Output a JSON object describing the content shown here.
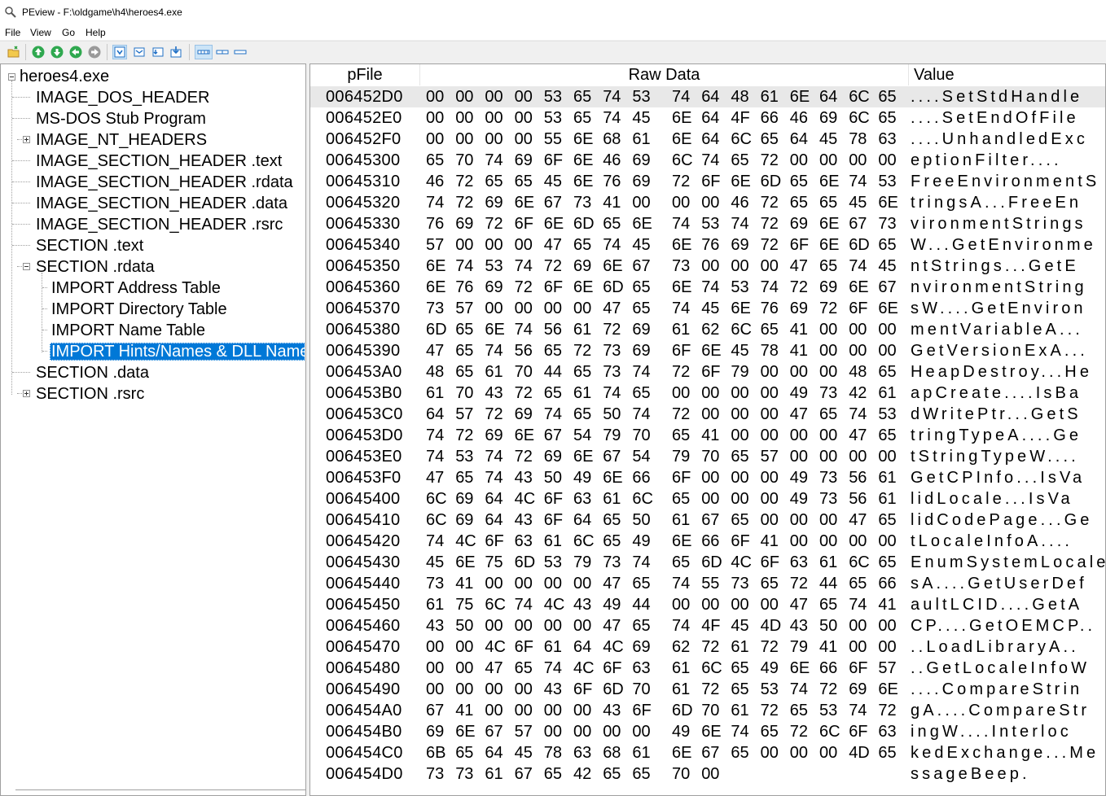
{
  "window": {
    "title": "PEview - F:\\oldgame\\h4\\heroes4.exe",
    "icon": "magnifier-icon"
  },
  "menu": [
    "File",
    "View",
    "Go",
    "Help"
  ],
  "toolbar": {
    "icons": [
      "open-folder-icon",
      "go-first-icon",
      "go-next-icon",
      "go-back-icon",
      "go-forward-icon",
      "view-byte-icon",
      "view-word-icon",
      "view-dword-icon",
      "view-qword-icon",
      "view-address-icon",
      "view-section-icon",
      "view-list-icon"
    ]
  },
  "tree": {
    "root": "heroes4.exe",
    "items": [
      {
        "label": "IMAGE_DOS_HEADER"
      },
      {
        "label": "MS-DOS Stub Program"
      },
      {
        "label": "IMAGE_NT_HEADERS",
        "expander": "plus"
      },
      {
        "label": "IMAGE_SECTION_HEADER .text"
      },
      {
        "label": "IMAGE_SECTION_HEADER .rdata"
      },
      {
        "label": "IMAGE_SECTION_HEADER .data"
      },
      {
        "label": "IMAGE_SECTION_HEADER .rsrc"
      },
      {
        "label": "SECTION .text"
      },
      {
        "label": "SECTION .rdata",
        "expander": "minus"
      },
      {
        "label": "IMPORT Address Table"
      },
      {
        "label": "IMPORT Directory Table"
      },
      {
        "label": "IMPORT Name Table"
      },
      {
        "label": "IMPORT Hints/Names & DLL Names",
        "selected": true
      },
      {
        "label": "SECTION .data"
      },
      {
        "label": "SECTION .rsrc",
        "expander": "plus"
      }
    ]
  },
  "columns": {
    "pfile": "pFile",
    "raw": "Raw Data",
    "value": "Value"
  },
  "rows": [
    {
      "addr": "006452D0",
      "h1": "00 00 00 00 53 65 74 53",
      "h2": "74 64 48 61 6E 64 6C 65",
      "val": "....SetStdHandle"
    },
    {
      "addr": "006452E0",
      "h1": "00 00 00 00 53 65 74 45",
      "h2": "6E 64 4F 66 46 69 6C 65",
      "val": "....SetEndOfFile"
    },
    {
      "addr": "006452F0",
      "h1": "00 00 00 00 55 6E 68 61",
      "h2": "6E 64 6C 65 64 45 78 63",
      "val": "....UnhandledExc"
    },
    {
      "addr": "00645300",
      "h1": "65 70 74 69 6F 6E 46 69",
      "h2": "6C 74 65 72 00 00 00 00",
      "val": "eptionFilter...."
    },
    {
      "addr": "00645310",
      "h1": "46 72 65 65 45 6E 76 69",
      "h2": "72 6F 6E 6D 65 6E 74 53",
      "val": "FreeEnvironmentS"
    },
    {
      "addr": "00645320",
      "h1": "74 72 69 6E 67 73 41 00",
      "h2": "00 00 46 72 65 65 45 6E",
      "val": "tringsA...FreeEn"
    },
    {
      "addr": "00645330",
      "h1": "76 69 72 6F 6E 6D 65 6E",
      "h2": "74 53 74 72 69 6E 67 73",
      "val": "vironmentStrings"
    },
    {
      "addr": "00645340",
      "h1": "57 00 00 00 47 65 74 45",
      "h2": "6E 76 69 72 6F 6E 6D 65",
      "val": "W...GetEnvironme"
    },
    {
      "addr": "00645350",
      "h1": "6E 74 53 74 72 69 6E 67",
      "h2": "73 00 00 00 47 65 74 45",
      "val": "ntStrings...GetE"
    },
    {
      "addr": "00645360",
      "h1": "6E 76 69 72 6F 6E 6D 65",
      "h2": "6E 74 53 74 72 69 6E 67",
      "val": "nvironmentString"
    },
    {
      "addr": "00645370",
      "h1": "73 57 00 00 00 00 47 65",
      "h2": "74 45 6E 76 69 72 6F 6E",
      "val": "sW....GetEnviron"
    },
    {
      "addr": "00645380",
      "h1": "6D 65 6E 74 56 61 72 69",
      "h2": "61 62 6C 65 41 00 00 00",
      "val": "mentVariableA..."
    },
    {
      "addr": "00645390",
      "h1": "47 65 74 56 65 72 73 69",
      "h2": "6F 6E 45 78 41 00 00 00",
      "val": "GetVersionExA..."
    },
    {
      "addr": "006453A0",
      "h1": "48 65 61 70 44 65 73 74",
      "h2": "72 6F 79 00 00 00 48 65",
      "val": "HeapDestroy...He"
    },
    {
      "addr": "006453B0",
      "h1": "61 70 43 72 65 61 74 65",
      "h2": "00 00 00 00 49 73 42 61",
      "val": "apCreate....IsBa"
    },
    {
      "addr": "006453C0",
      "h1": "64 57 72 69 74 65 50 74",
      "h2": "72 00 00 00 47 65 74 53",
      "val": "dWritePtr...GetS"
    },
    {
      "addr": "006453D0",
      "h1": "74 72 69 6E 67 54 79 70",
      "h2": "65 41 00 00 00 00 47 65",
      "val": "tringTypeA....Ge"
    },
    {
      "addr": "006453E0",
      "h1": "74 53 74 72 69 6E 67 54",
      "h2": "79 70 65 57 00 00 00 00",
      "val": "tStringTypeW...."
    },
    {
      "addr": "006453F0",
      "h1": "47 65 74 43 50 49 6E 66",
      "h2": "6F 00 00 00 49 73 56 61",
      "val": "GetCPInfo...IsVa"
    },
    {
      "addr": "00645400",
      "h1": "6C 69 64 4C 6F 63 61 6C",
      "h2": "65 00 00 00 49 73 56 61",
      "val": "lidLocale...IsVa"
    },
    {
      "addr": "00645410",
      "h1": "6C 69 64 43 6F 64 65 50",
      "h2": "61 67 65 00 00 00 47 65",
      "val": "lidCodePage...Ge"
    },
    {
      "addr": "00645420",
      "h1": "74 4C 6F 63 61 6C 65 49",
      "h2": "6E 66 6F 41 00 00 00 00",
      "val": "tLocaleInfoA...."
    },
    {
      "addr": "00645430",
      "h1": "45 6E 75 6D 53 79 73 74",
      "h2": "65 6D 4C 6F 63 61 6C 65",
      "val": "EnumSystemLocale"
    },
    {
      "addr": "00645440",
      "h1": "73 41 00 00 00 00 47 65",
      "h2": "74 55 73 65 72 44 65 66",
      "val": "sA....GetUserDef"
    },
    {
      "addr": "00645450",
      "h1": "61 75 6C 74 4C 43 49 44",
      "h2": "00 00 00 00 47 65 74 41",
      "val": "aultLCID....GetA"
    },
    {
      "addr": "00645460",
      "h1": "43 50 00 00 00 00 47 65",
      "h2": "74 4F 45 4D 43 50 00 00",
      "val": "CP....GetOEMCP.."
    },
    {
      "addr": "00645470",
      "h1": "00 00 4C 6F 61 64 4C 69",
      "h2": "62 72 61 72 79 41 00 00",
      "val": "..LoadLibraryA.."
    },
    {
      "addr": "00645480",
      "h1": "00 00 47 65 74 4C 6F 63",
      "h2": "61 6C 65 49 6E 66 6F 57",
      "val": "..GetLocaleInfoW"
    },
    {
      "addr": "00645490",
      "h1": "00 00 00 00 43 6F 6D 70",
      "h2": "61 72 65 53 74 72 69 6E",
      "val": "....CompareStrin"
    },
    {
      "addr": "006454A0",
      "h1": "67 41 00 00 00 00 43 6F",
      "h2": "6D 70 61 72 65 53 74 72",
      "val": "gA....CompareStr"
    },
    {
      "addr": "006454B0",
      "h1": "69 6E 67 57 00 00 00 00",
      "h2": "49 6E 74 65 72 6C 6F 63",
      "val": "ingW....Interloc"
    },
    {
      "addr": "006454C0",
      "h1": "6B 65 64 45 78 63 68 61",
      "h2": "6E 67 65 00 00 00 4D 65",
      "val": "kedExchange...Me"
    },
    {
      "addr": "006454D0",
      "h1": "73 73 61 67 65 42 65 65",
      "h2": "70 00",
      "val": "ssageBeep."
    }
  ]
}
